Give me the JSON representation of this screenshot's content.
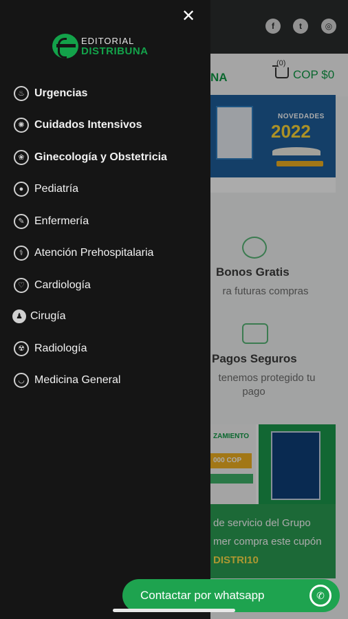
{
  "drawer": {
    "close_icon": "close-icon",
    "logo": {
      "top": "EDITORIAL",
      "bottom": "DISTRIBUNA"
    },
    "menu": [
      {
        "label": "Urgencias",
        "icon": "flame-icon"
      },
      {
        "label": "Cuidados Intensivos",
        "icon": "virus-icon"
      },
      {
        "label": "Ginecología y Obstetricia",
        "icon": "flower-icon"
      },
      {
        "label": "Pediatría",
        "icon": "pacifier-icon"
      },
      {
        "label": "Enfermería",
        "icon": "syringe-icon"
      },
      {
        "label": "Atención Prehospitalaria",
        "icon": "caduceus-icon"
      },
      {
        "label": "Cardiología",
        "icon": "heart-icon"
      },
      {
        "label": "Cirugía",
        "icon": "surgeon-icon"
      },
      {
        "label": "Radiología",
        "icon": "radiation-icon"
      },
      {
        "label": "Medicina General",
        "icon": "stethoscope-icon"
      }
    ]
  },
  "page": {
    "header": {
      "social": [
        "f",
        "t",
        "◎"
      ],
      "brand_fragment": "NA",
      "cart_count": "(0)",
      "cart_total": "COP $0"
    },
    "banner1": {
      "title": "NOVEDADES",
      "year": "2022"
    },
    "features": [
      {
        "title": "Bonos Gratis",
        "subtitle": "ra futuras compras"
      },
      {
        "title": "Pagos Seguros",
        "subtitle_line1": "tenemos protegido tu",
        "subtitle_line2": "pago"
      }
    ],
    "banner2": {
      "tag": "ZAMIENTO",
      "price": "000 COP"
    },
    "promo": {
      "line1": "de servicio del Grupo",
      "line2": "mer compra este cupón",
      "code": "DISTRI10"
    }
  },
  "whatsapp": {
    "label": "Contactar por whatsapp",
    "icon": "whatsapp-icon"
  },
  "colors": {
    "brand_green": "#13a24a",
    "drawer_bg": "#151515",
    "whatsapp_green": "#1ea34f"
  }
}
